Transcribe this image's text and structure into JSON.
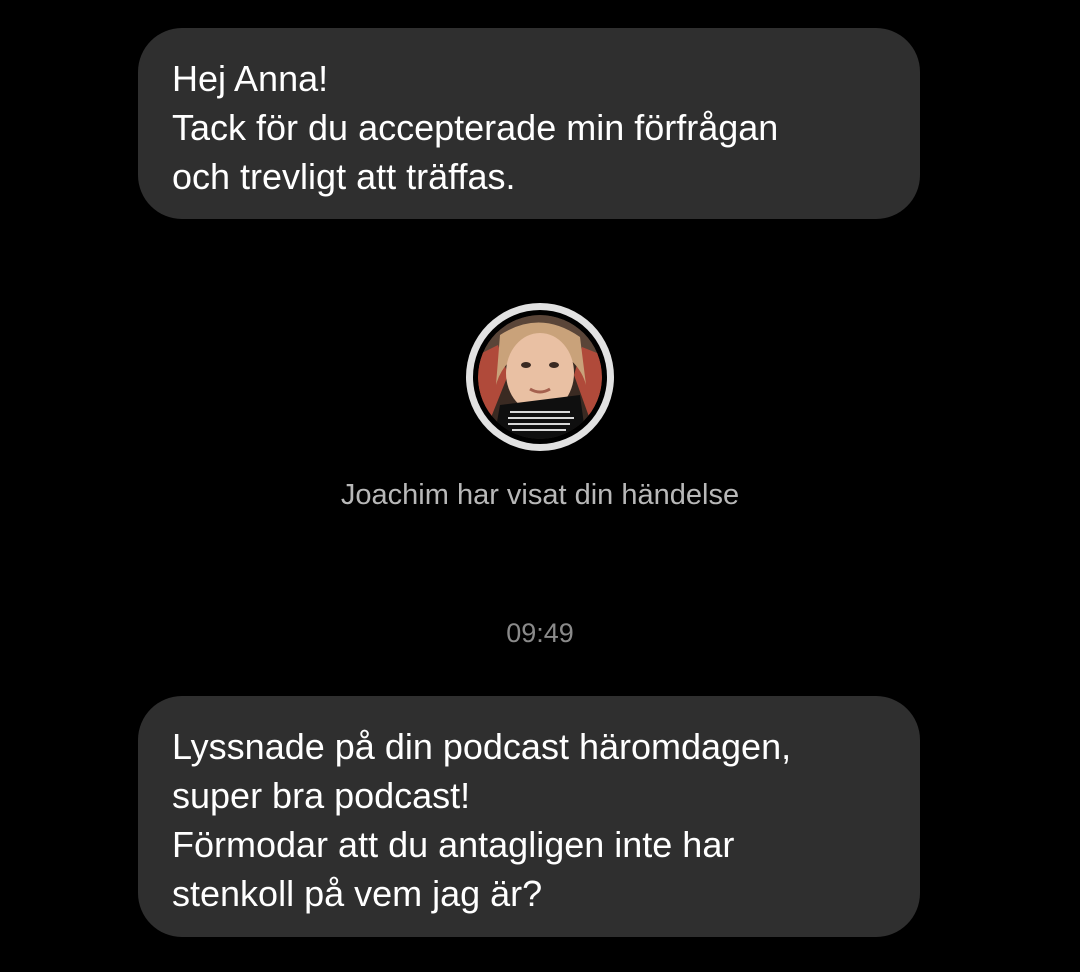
{
  "messages": [
    {
      "lines": [
        "Hej Anna!",
        "Tack för du accepterade min förfrågan",
        "och trevligt att träffas."
      ]
    },
    {
      "lines": [
        "Lyssnade på din podcast häromdagen,",
        "super bra podcast!",
        "Förmodar att du antagligen inte har",
        "stenkoll på vem jag är?"
      ]
    }
  ],
  "story": {
    "caption": "Joachim har visat din händelse"
  },
  "timestamp": "09:49",
  "colors": {
    "background": "#000000",
    "bubble": "#2f2f2f",
    "text": "#ffffff",
    "caption": "#b8b8b8",
    "timestamp": "#8a8a8a",
    "ring": "#e2e2e2"
  }
}
